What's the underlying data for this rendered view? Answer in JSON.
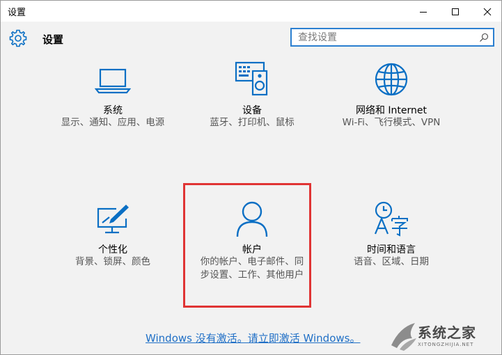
{
  "window": {
    "title": "设置"
  },
  "header": {
    "title": "设置",
    "search_placeholder": "查找设置"
  },
  "tiles": [
    {
      "name": "系统",
      "desc": "显示、通知、应用、电源",
      "icon": "laptop-icon"
    },
    {
      "name": "设备",
      "desc": "蓝牙、打印机、鼠标",
      "icon": "devices-icon"
    },
    {
      "name": "网络和 Internet",
      "desc": "Wi-Fi、飞行模式、VPN",
      "icon": "globe-icon"
    },
    {
      "name": "个性化",
      "desc": "背景、锁屏、颜色",
      "icon": "personalization-icon"
    },
    {
      "name": "帐户",
      "desc": "你的帐户、电子邮件、同步设置、工作、其他用户",
      "icon": "person-icon"
    },
    {
      "name": "时间和语言",
      "desc": "语音、区域、日期",
      "icon": "time-language-icon"
    }
  ],
  "activation": {
    "link": "Windows 没有激活。请立即激活 Windows。"
  },
  "watermark": {
    "text": "系统之家",
    "sub": "XITONGZHIJIA.NET"
  },
  "colors": {
    "accent": "#0a6fc4",
    "highlight": "#e03434",
    "link": "#1f6fc6"
  }
}
